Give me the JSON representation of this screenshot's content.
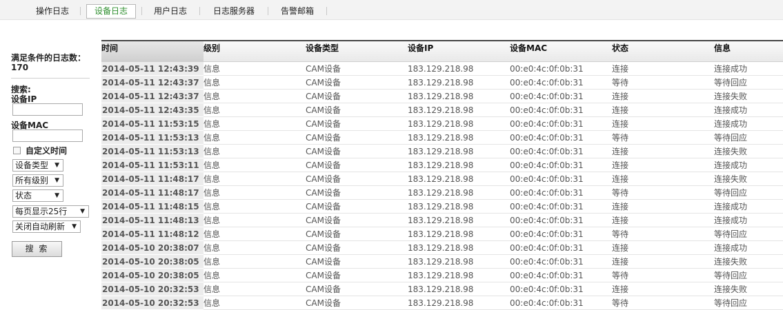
{
  "tabs": [
    {
      "label": "操作日志",
      "active": false
    },
    {
      "label": "设备日志",
      "active": true
    },
    {
      "label": "用户日志",
      "active": false
    },
    {
      "label": "日志服务器",
      "active": false
    },
    {
      "label": "告警邮箱",
      "active": false
    }
  ],
  "sidebar": {
    "count_label": "满足条件的日志数：",
    "count_value": "170",
    "search_label": "搜索:",
    "ip_label": "设备IP",
    "ip_value": "",
    "mac_label": "设备MAC",
    "mac_value": "",
    "custom_time_label": "自定义时间",
    "custom_time_checked": false,
    "selects": {
      "device_type": "设备类型",
      "level": "所有级别",
      "status": "状态",
      "page_size": "每页显示25行",
      "auto_refresh": "关闭自动刷新"
    },
    "search_button": "搜 索"
  },
  "table": {
    "headers": [
      "时间",
      "级别",
      "设备类型",
      "设备IP",
      "设备MAC",
      "状态",
      "信息"
    ],
    "rows": [
      [
        "2014-05-11 12:43:39",
        "信息",
        "CAM设备",
        "183.129.218.98",
        "00:e0:4c:0f:0b:31",
        "连接",
        "连接成功"
      ],
      [
        "2014-05-11 12:43:37",
        "信息",
        "CAM设备",
        "183.129.218.98",
        "00:e0:4c:0f:0b:31",
        "等待",
        "等待回应"
      ],
      [
        "2014-05-11 12:43:37",
        "信息",
        "CAM设备",
        "183.129.218.98",
        "00:e0:4c:0f:0b:31",
        "连接",
        "连接失败"
      ],
      [
        "2014-05-11 12:43:35",
        "信息",
        "CAM设备",
        "183.129.218.98",
        "00:e0:4c:0f:0b:31",
        "连接",
        "连接成功"
      ],
      [
        "2014-05-11 11:53:15",
        "信息",
        "CAM设备",
        "183.129.218.98",
        "00:e0:4c:0f:0b:31",
        "连接",
        "连接成功"
      ],
      [
        "2014-05-11 11:53:13",
        "信息",
        "CAM设备",
        "183.129.218.98",
        "00:e0:4c:0f:0b:31",
        "等待",
        "等待回应"
      ],
      [
        "2014-05-11 11:53:13",
        "信息",
        "CAM设备",
        "183.129.218.98",
        "00:e0:4c:0f:0b:31",
        "连接",
        "连接失败"
      ],
      [
        "2014-05-11 11:53:11",
        "信息",
        "CAM设备",
        "183.129.218.98",
        "00:e0:4c:0f:0b:31",
        "连接",
        "连接成功"
      ],
      [
        "2014-05-11 11:48:17",
        "信息",
        "CAM设备",
        "183.129.218.98",
        "00:e0:4c:0f:0b:31",
        "连接",
        "连接失败"
      ],
      [
        "2014-05-11 11:48:17",
        "信息",
        "CAM设备",
        "183.129.218.98",
        "00:e0:4c:0f:0b:31",
        "等待",
        "等待回应"
      ],
      [
        "2014-05-11 11:48:15",
        "信息",
        "CAM设备",
        "183.129.218.98",
        "00:e0:4c:0f:0b:31",
        "连接",
        "连接成功"
      ],
      [
        "2014-05-11 11:48:13",
        "信息",
        "CAM设备",
        "183.129.218.98",
        "00:e0:4c:0f:0b:31",
        "连接",
        "连接成功"
      ],
      [
        "2014-05-11 11:48:12",
        "信息",
        "CAM设备",
        "183.129.218.98",
        "00:e0:4c:0f:0b:31",
        "等待",
        "等待回应"
      ],
      [
        "2014-05-10 20:38:07",
        "信息",
        "CAM设备",
        "183.129.218.98",
        "00:e0:4c:0f:0b:31",
        "连接",
        "连接成功"
      ],
      [
        "2014-05-10 20:38:05",
        "信息",
        "CAM设备",
        "183.129.218.98",
        "00:e0:4c:0f:0b:31",
        "连接",
        "连接失败"
      ],
      [
        "2014-05-10 20:38:05",
        "信息",
        "CAM设备",
        "183.129.218.98",
        "00:e0:4c:0f:0b:31",
        "等待",
        "等待回应"
      ],
      [
        "2014-05-10 20:32:53",
        "信息",
        "CAM设备",
        "183.129.218.98",
        "00:e0:4c:0f:0b:31",
        "连接",
        "连接失败"
      ],
      [
        "2014-05-10 20:32:53",
        "信息",
        "CAM设备",
        "183.129.218.98",
        "00:e0:4c:0f:0b:31",
        "等待",
        "等待回应"
      ]
    ]
  }
}
